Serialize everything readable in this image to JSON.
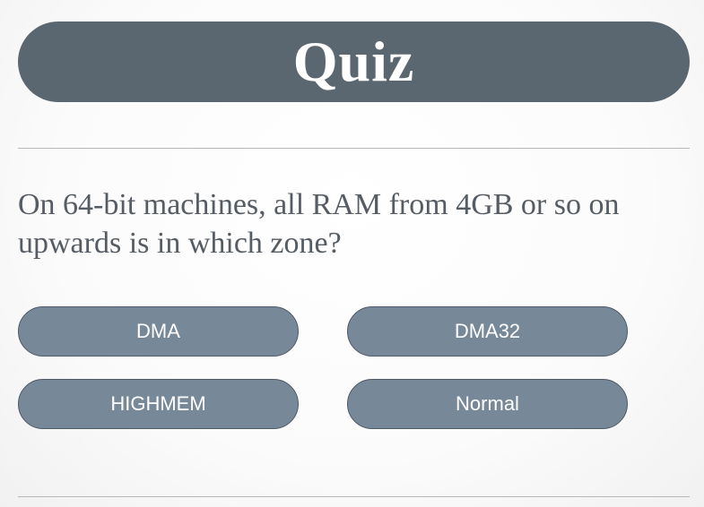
{
  "header": {
    "title": "Quiz"
  },
  "question": {
    "text": "On 64-bit machines, all RAM from 4GB or so on upwards is in which zone?"
  },
  "answers": [
    {
      "label": "DMA"
    },
    {
      "label": "DMA32"
    },
    {
      "label": "HIGHMEM"
    },
    {
      "label": "Normal"
    }
  ],
  "colors": {
    "title_bar": "#5a6670",
    "button_fill": "#778899",
    "button_border": "#4e5a66",
    "question_text": "#555c63"
  }
}
